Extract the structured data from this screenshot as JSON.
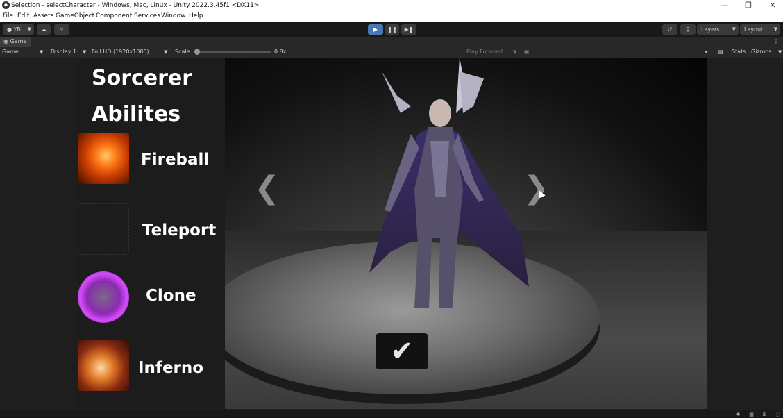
{
  "window": {
    "title": "Selection - selectCharacter - Windows, Mac, Linux - Unity 2022.3.45f1 <DX11>",
    "controls": [
      "—",
      "❐",
      "✕"
    ]
  },
  "menu": [
    "File",
    "Edit",
    "Assets",
    "GameObject",
    "Component",
    "Services",
    "Window",
    "Help"
  ],
  "toolbar": {
    "account_label": "YB",
    "layers_label": "Layers",
    "layout_label": "Layout"
  },
  "tab": {
    "label": "Game"
  },
  "gamebar": {
    "mode": "Game",
    "display": "Display 1",
    "resolution": "Full HD (1920x1080)",
    "scale_label": "Scale",
    "scale_value": "0.8x",
    "scale_level": 0.03,
    "play_mode": "Play Focused",
    "stats_label": "Stats",
    "gizmos_label": "Gizmos"
  },
  "game": {
    "character_name": "Sorcerer",
    "abilities_heading": "Abilites",
    "abilities": [
      {
        "name": "Fireball",
        "icon": "fireball-icon"
      },
      {
        "name": "Teleport",
        "icon": "teleport-icon"
      },
      {
        "name": "Clone",
        "icon": "clone-icon"
      },
      {
        "name": "Inferno",
        "icon": "inferno-icon"
      }
    ],
    "prev_arrow": "❮",
    "next_arrow": "❯",
    "confirm_glyph": "✔"
  },
  "colors": {
    "play_button": "#4a78b5",
    "editor_bg": "#191919",
    "panel_bg": "#282828",
    "ability_text": "#ffffff"
  }
}
